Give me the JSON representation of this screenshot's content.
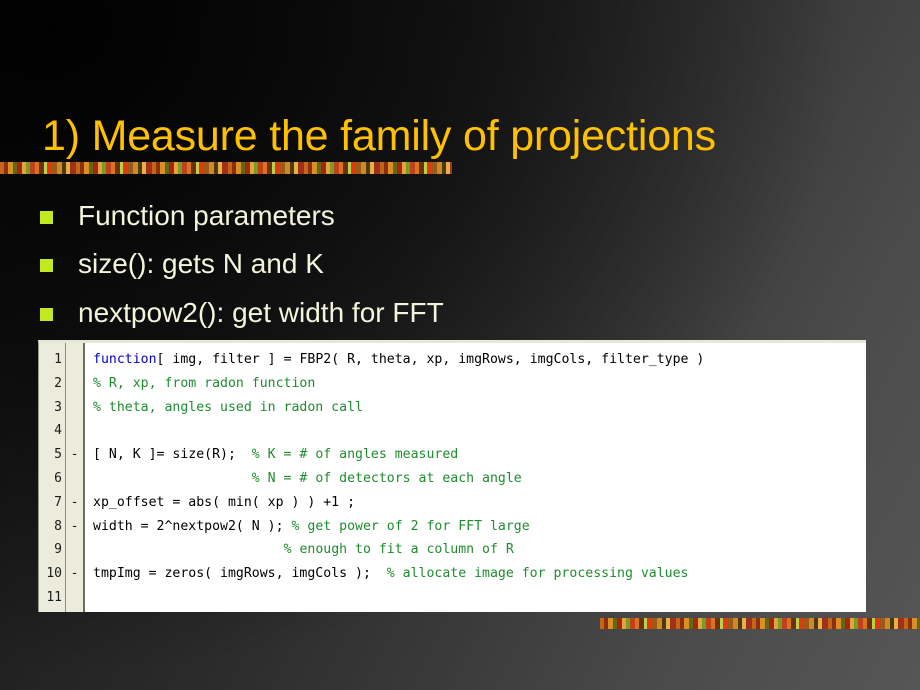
{
  "slide": {
    "title": "1) Measure the family of projections",
    "bullets": [
      {
        "marker": "square-bullet",
        "text": "Function parameters"
      },
      {
        "marker": "square-bullet",
        "text": "size():  gets N and K"
      },
      {
        "marker": "square-bullet",
        "text": "nextpow2():  get width for FFT"
      }
    ],
    "colors": {
      "title": "#FFC000",
      "bullet_marker": "#C2E81F",
      "body_text": "#F4F4DC",
      "code_keyword": "#0000CC",
      "code_comment": "#1F8C30",
      "code_text": "#000000",
      "code_background": "#FFFFFF",
      "gutter_background": "#ECECDC"
    },
    "decorations": [
      {
        "name": "mosaic-strip-top"
      },
      {
        "name": "mosaic-strip-bottom"
      }
    ]
  },
  "code_panel": {
    "language": "matlab",
    "line_numbers": [
      "1",
      "2",
      "3",
      "4",
      "5",
      "6",
      "7",
      "8",
      "9",
      "10",
      "11"
    ],
    "fold_marks": [
      "",
      "",
      "",
      "",
      "-",
      "",
      "-",
      "-",
      "",
      "-",
      ""
    ],
    "lines": [
      {
        "number": "1",
        "fold": "",
        "segments": [
          {
            "type": "keyword",
            "text": "function"
          },
          {
            "type": "code",
            "text": "[ img, filter ] = FBP2( R, theta, xp, imgRows, imgCols, filter_type )"
          }
        ]
      },
      {
        "number": "2",
        "fold": "",
        "segments": [
          {
            "type": "comment",
            "text": "% R, xp, from radon function"
          }
        ]
      },
      {
        "number": "3",
        "fold": "",
        "segments": [
          {
            "type": "comment",
            "text": "% theta, angles used in radon call"
          }
        ]
      },
      {
        "number": "4",
        "fold": "",
        "segments": []
      },
      {
        "number": "5",
        "fold": "-",
        "segments": [
          {
            "type": "code",
            "text": "[ N, K ]= size(R);  "
          },
          {
            "type": "comment",
            "text": "% K = # of angles measured"
          }
        ]
      },
      {
        "number": "6",
        "fold": "",
        "segments": [
          {
            "type": "code",
            "text": "                    "
          },
          {
            "type": "comment",
            "text": "% N = # of detectors at each angle"
          }
        ]
      },
      {
        "number": "7",
        "fold": "-",
        "segments": [
          {
            "type": "code",
            "text": "xp_offset = abs( min( xp ) ) +1 ;"
          }
        ]
      },
      {
        "number": "8",
        "fold": "-",
        "segments": [
          {
            "type": "code",
            "text": "width = 2^nextpow2( N ); "
          },
          {
            "type": "comment",
            "text": "% get power of 2 for FFT large"
          }
        ]
      },
      {
        "number": "9",
        "fold": "",
        "segments": [
          {
            "type": "code",
            "text": "                        "
          },
          {
            "type": "comment",
            "text": "% enough to fit a column of R"
          }
        ]
      },
      {
        "number": "10",
        "fold": "-",
        "segments": [
          {
            "type": "code",
            "text": "tmpImg = zeros( imgRows, imgCols );  "
          },
          {
            "type": "comment",
            "text": "% allocate image for processing values"
          }
        ]
      },
      {
        "number": "11",
        "fold": "",
        "segments": []
      }
    ]
  }
}
